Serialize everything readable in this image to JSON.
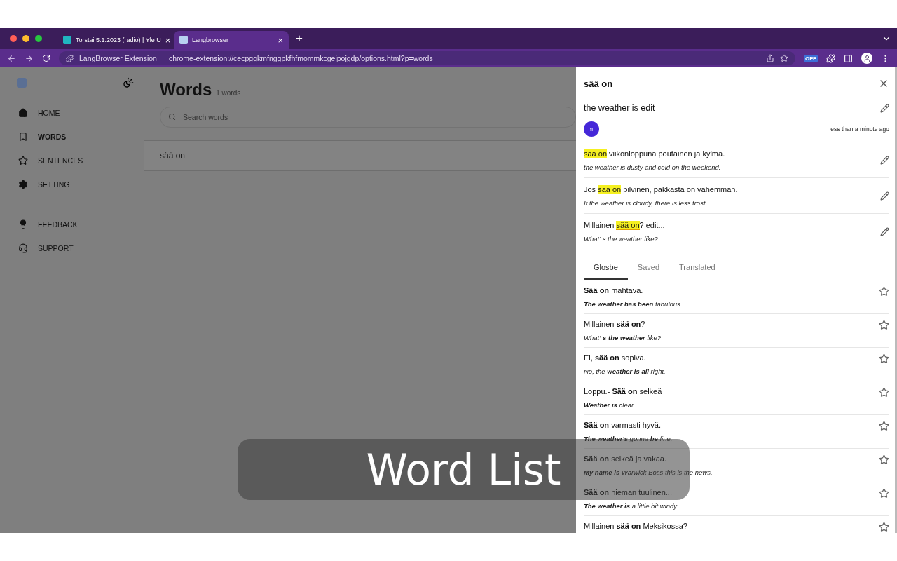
{
  "browser": {
    "tabs": [
      {
        "title": "Torstai 5.1.2023 (radio) | Yle U",
        "close": "×",
        "selected": false
      },
      {
        "title": "Langbrowser",
        "close": "×",
        "selected": true
      }
    ],
    "new_tab": "+",
    "address": {
      "site": "LangBrowser Extension",
      "url": "chrome-extension://cecpggkmfnggpkfhfmommkcgejpojgdp/options.html?p=words"
    },
    "extension_badge": "OFF"
  },
  "sidebar": {
    "items": [
      {
        "label": "HOME",
        "selected": false
      },
      {
        "label": "WORDS",
        "selected": true
      },
      {
        "label": "SENTENCES",
        "selected": false
      },
      {
        "label": "SETTING",
        "selected": false
      }
    ],
    "extra_items": [
      {
        "label": "FEEDBACK"
      },
      {
        "label": "SUPPORT"
      }
    ]
  },
  "main": {
    "title": "Words",
    "count": "1 words",
    "search": {
      "placeholder": "Search words"
    },
    "words": [
      "sää on"
    ]
  },
  "drawer": {
    "word": "sää on",
    "translation": "the weather is edit",
    "language": "fi",
    "time": "less than a minute ago",
    "examples": [
      {
        "highlight": "sää on",
        "after": " viikonloppuna poutainen ja kylmä.",
        "translation": "the weather is dusty and cold on the weekend."
      },
      {
        "before": "Jos ",
        "highlight": "sää on",
        "after": " pilvinen, pakkasta on vähemmän.",
        "translation": "If the weather is cloudy, there is less frost."
      },
      {
        "before": "Millainen ",
        "highlight": "sää on",
        "after": "? edit...",
        "translation": "What' s the weather like?"
      }
    ],
    "tabs": [
      {
        "label": "Glosbe",
        "selected": true
      },
      {
        "label": "Saved",
        "selected": false
      },
      {
        "label": "Translated",
        "selected": false
      }
    ],
    "results": [
      {
        "text": "**Sää on** mahtava.",
        "translation": "**The weather has been** fabulous.",
        "starred": false
      },
      {
        "text": "Millainen **sää on**?",
        "translation": "What**' s the weather** like?",
        "starred": false
      },
      {
        "text": "Ei, **sää on** sopiva.",
        "translation": "No, the **weather is all** right.",
        "starred": false
      },
      {
        "text": "Loppu.- **Sää on** selkeä",
        "translation": "**Weather is** clear",
        "starred": false
      },
      {
        "text": "**Sää on** varmasti hyvä.",
        "translation": "**The weather's** gonna **be** fine.",
        "starred": false
      },
      {
        "text": "**Sää on** selkeä ja vakaa.",
        "translation": "**My name is** Warwick Boss this is the news.",
        "starred": false
      },
      {
        "text": "**Sää on** hieman tuulinen...",
        "translation": "**The weather is** a little bit windy....",
        "starred": false
      },
      {
        "text": "Millainen **sää on** Meksikossa?",
        "starred": false
      }
    ]
  },
  "caption": "Word List"
}
